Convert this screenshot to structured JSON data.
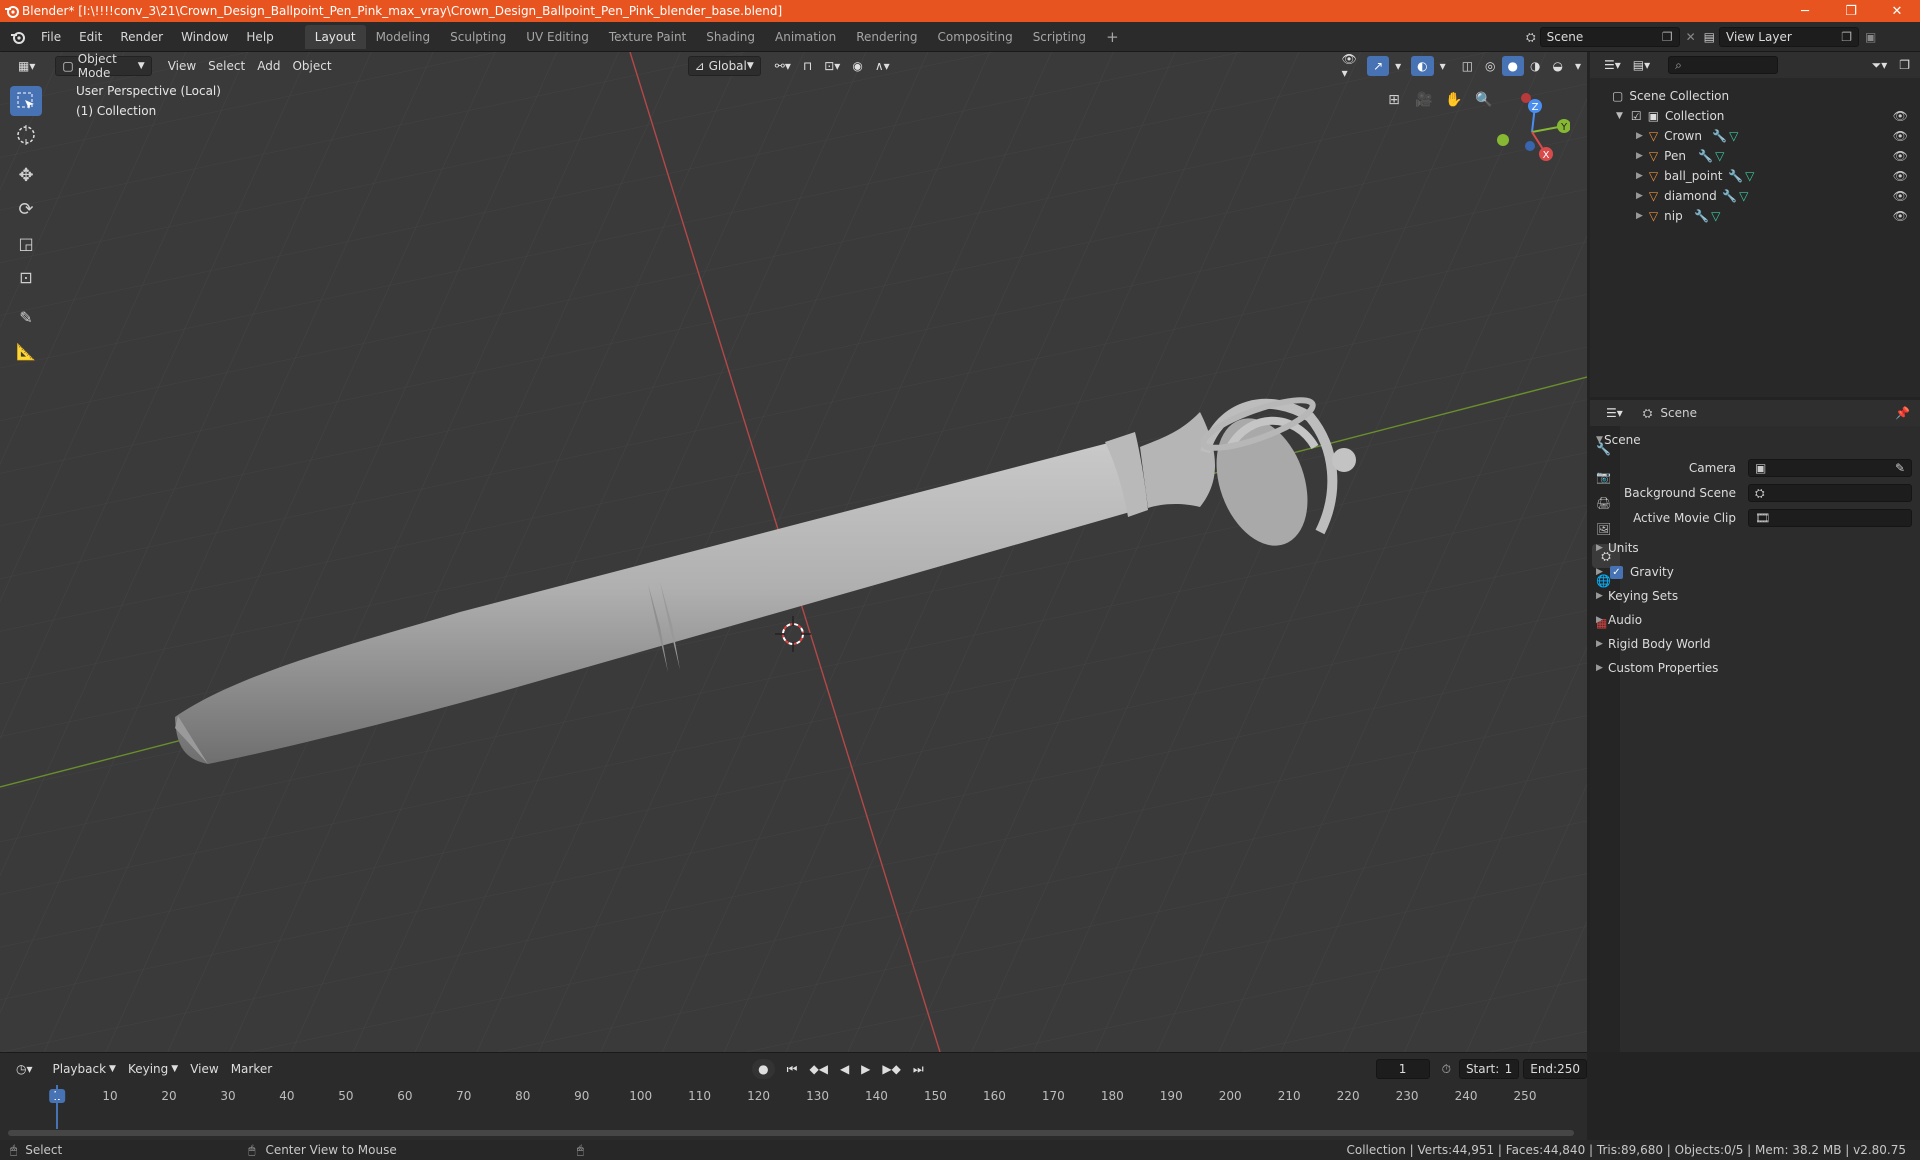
{
  "window": {
    "title": "Blender* [I:\\!!!!conv_3\\21\\Crown_Design_Ballpoint_Pen_Pink_max_vray\\Crown_Design_Ballpoint_Pen_Pink_blender_base.blend]",
    "minimize": "─",
    "maximize": "❐",
    "close": "✕"
  },
  "menu": [
    "File",
    "Edit",
    "Render",
    "Window",
    "Help"
  ],
  "workspaces": [
    "Layout",
    "Modeling",
    "Sculpting",
    "UV Editing",
    "Texture Paint",
    "Shading",
    "Animation",
    "Rendering",
    "Compositing",
    "Scripting"
  ],
  "workspace_add": "+",
  "scene_field": "Scene",
  "view_layer_field": "View Layer",
  "viewport": {
    "mode": "Object Mode",
    "menus": [
      "View",
      "Select",
      "Add",
      "Object"
    ],
    "transform_orientation": "Global",
    "overlay_line1": "User Perspective (Local)",
    "overlay_line2": "(1) Collection",
    "gizmo": {
      "z": "Z",
      "y": "Y",
      "x": "X"
    }
  },
  "outliner": {
    "search_placeholder": "",
    "root": "Scene Collection",
    "collection": "Collection",
    "objects": [
      "Crown",
      "Pen",
      "ball_point",
      "diamond",
      "nip"
    ]
  },
  "properties": {
    "context": "Scene",
    "panel": "Scene",
    "camera_label": "Camera",
    "background_scene_label": "Background Scene",
    "active_clip_label": "Active Movie Clip",
    "subpanels": [
      "Units",
      "Gravity",
      "Keying Sets",
      "Audio",
      "Rigid Body World",
      "Custom Properties"
    ]
  },
  "timeline": {
    "menus": [
      "Playback",
      "Keying",
      "View",
      "Marker"
    ],
    "current_frame": "1",
    "start_label": "Start:",
    "start": "1",
    "end_label": "End:",
    "end": "250",
    "ticks": [
      "1",
      "10",
      "20",
      "30",
      "40",
      "50",
      "60",
      "70",
      "80",
      "90",
      "100",
      "110",
      "120",
      "130",
      "140",
      "150",
      "160",
      "170",
      "180",
      "190",
      "200",
      "210",
      "220",
      "230",
      "240",
      "250"
    ]
  },
  "status": {
    "select": "Select",
    "center": "Center View to Mouse",
    "stats": "Collection | Verts:44,951 | Faces:44,840 | Tris:89,680 | Objects:0/5 | Mem: 38.2 MB | v2.80.75"
  },
  "colors": {
    "accent": "#4772b3",
    "titlebar": "#e8541f",
    "x_axis": "#d94b4b",
    "y_axis": "#86b833",
    "z_axis": "#4a8ff0",
    "mesh_icon": "#e8913a"
  }
}
